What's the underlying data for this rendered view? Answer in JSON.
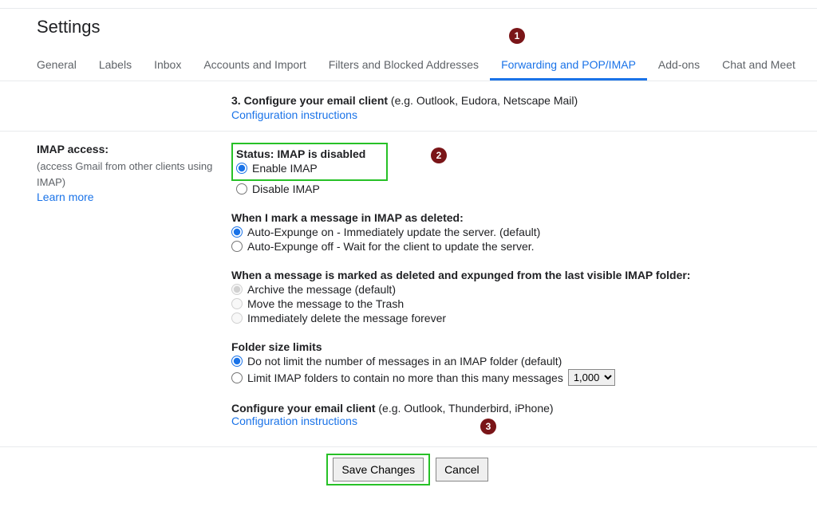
{
  "title": "Settings",
  "tabs": [
    "General",
    "Labels",
    "Inbox",
    "Accounts and Import",
    "Filters and Blocked Addresses",
    "Forwarding and POP/IMAP",
    "Add-ons",
    "Chat and Meet"
  ],
  "step3": {
    "number_label": "3. Configure your email client",
    "example": " (e.g. Outlook, Eudora, Netscape Mail)",
    "link": "Configuration instructions"
  },
  "left": {
    "title": "IMAP access:",
    "desc": "(access Gmail from other clients using IMAP)",
    "learn": "Learn more"
  },
  "status_block": {
    "title": "Status: IMAP is disabled",
    "enable": "Enable IMAP",
    "disable": "Disable IMAP"
  },
  "deleted_block": {
    "title": "When I mark a message in IMAP as deleted:",
    "on": "Auto-Expunge on - Immediately update the server. (default)",
    "off": "Auto-Expunge off - Wait for the client to update the server."
  },
  "expunge_block": {
    "title": "When a message is marked as deleted and expunged from the last visible IMAP folder:",
    "archive": "Archive the message (default)",
    "trash": "Move the message to the Trash",
    "delete": "Immediately delete the message forever"
  },
  "folder_block": {
    "title": "Folder size limits",
    "nolimit": "Do not limit the number of messages in an IMAP folder (default)",
    "limit": "Limit IMAP folders to contain no more than this many messages",
    "limit_value": "1,000"
  },
  "config_block": {
    "title": "Configure your email client",
    "example": " (e.g. Outlook, Thunderbird, iPhone)",
    "link": "Configuration instructions"
  },
  "buttons": {
    "save": "Save Changes",
    "cancel": "Cancel"
  },
  "badges": {
    "b1": "1",
    "b2": "2",
    "b3": "3"
  }
}
